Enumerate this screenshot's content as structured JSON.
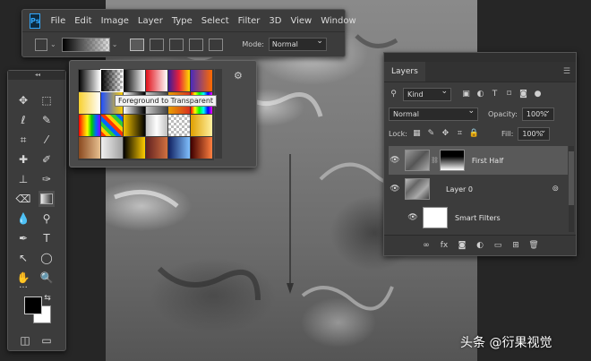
{
  "menubar": {
    "app_logo": "Ps",
    "items": [
      "File",
      "Edit",
      "Image",
      "Layer",
      "Type",
      "Select",
      "Filter",
      "3D",
      "View",
      "Window"
    ],
    "mode_label": "Mode:",
    "mode_value": "Normal"
  },
  "gradient_picker": {
    "tooltip": "Foreground to Transparent",
    "swatches": [
      "linear-gradient(90deg,#000,#fff)",
      "linear-gradient(90deg,#000,transparent),repeating-conic-gradient(#bbb 0 25%,#fff 0 50%) 0 0/6px 6px",
      "linear-gradient(90deg,#000,#fff)",
      "linear-gradient(90deg,#e0101a,#fff)",
      "linear-gradient(90deg,#3a1c9a,#e8203a,#ffdd00)",
      "linear-gradient(90deg,#4a2bbb,#ff6a00)",
      "linear-gradient(90deg,#f8d030,#fff)",
      "linear-gradient(90deg,#2050ff,#ffd000)",
      "linear-gradient(90deg,#fff,#000)",
      "linear-gradient(90deg,#c8c8c8,#444)",
      "linear-gradient(90deg,#e8a000,#d83020)",
      "linear-gradient(90deg,#ff0000,#ffff00,#00ff00,#00ffff,#0000ff,#ff00ff)",
      "linear-gradient(90deg,#ff0000,#ff8800,#ffff00,#00cc00,#0066ff,#8800ff)",
      "repeating-linear-gradient(45deg,#ff3300 0 4px,#ffcc00 4px 8px,#33cc33 8px 12px,#0066ff 12px 16px)",
      "linear-gradient(90deg,#f0c000,#000)",
      "linear-gradient(90deg,#c0c0c0,#fff,#c0c0c0)",
      "repeating-conic-gradient(#bbb 0 25%,#fff 0 50%) 0 0/6px 6px",
      "linear-gradient(90deg,#e0a000,#fff0a0)",
      "linear-gradient(90deg,#8a4a20,#e8c090)",
      "linear-gradient(90deg,#f0f0f0,#a0a0a0)",
      "linear-gradient(90deg,#000,#ffcc00)",
      "linear-gradient(90deg,#602020,#d07040)",
      "linear-gradient(90deg,#102060,#80c0ff)",
      "linear-gradient(90deg,#400000,#ff8040)"
    ]
  },
  "layers_panel": {
    "tab": "Layers",
    "filter_kind": "Kind",
    "blend_mode": "Normal",
    "opacity_label": "Opacity:",
    "opacity_value": "100%",
    "lock_label": "Lock:",
    "fill_label": "Fill:",
    "fill_value": "100%",
    "layers": [
      {
        "name": "First Half",
        "selected": true
      },
      {
        "name": "Layer 0",
        "selected": false
      },
      {
        "name": "Smart Filters",
        "selected": false
      }
    ]
  },
  "watermark": "头条 @衍果视觉"
}
